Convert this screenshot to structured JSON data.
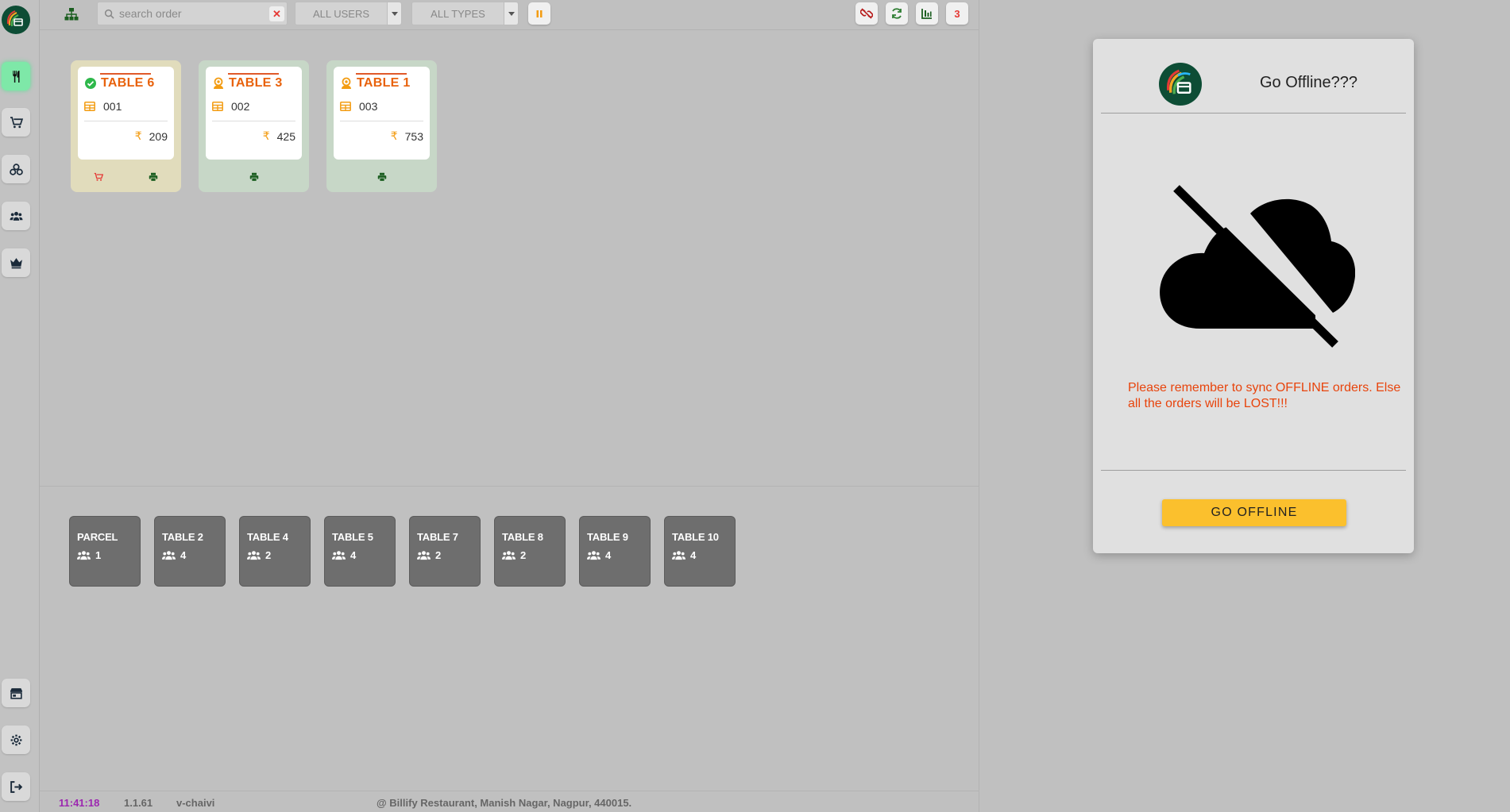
{
  "topbar": {
    "search_placeholder": "search order",
    "users_select": "ALL USERS",
    "types_select": "ALL TYPES",
    "badge_count": "3"
  },
  "occupied_tables": [
    {
      "name": "TABLE 6",
      "status": "ready",
      "order_no": "001",
      "amount": "209",
      "actions": [
        "cart-icon",
        "print-icon"
      ]
    },
    {
      "name": "TABLE 3",
      "status": "waiter",
      "order_no": "002",
      "amount": "425",
      "actions": [
        "print-icon"
      ]
    },
    {
      "name": "TABLE 1",
      "status": "waiter",
      "order_no": "003",
      "amount": "753",
      "actions": [
        "print-icon"
      ]
    }
  ],
  "currency_symbol": "₹",
  "free_tables": [
    {
      "name": "PARCEL",
      "seats": "1"
    },
    {
      "name": "TABLE 2",
      "seats": "4"
    },
    {
      "name": "TABLE 4",
      "seats": "2"
    },
    {
      "name": "TABLE 5",
      "seats": "4"
    },
    {
      "name": "TABLE 7",
      "seats": "2"
    },
    {
      "name": "TABLE 8",
      "seats": "2"
    },
    {
      "name": "TABLE 9",
      "seats": "4"
    },
    {
      "name": "TABLE 10",
      "seats": "4"
    }
  ],
  "footer": {
    "time": "11:41:18",
    "version": "1.1.61",
    "user": "v-chaivi",
    "address": "@ Billify Restaurant, Manish Nagar, Nagpur, 440015."
  },
  "modal": {
    "title": "Go Offline???",
    "warning": "Please remember to sync OFFLINE orders. Else all the orders will be LOST!!!",
    "button": "GO OFFLINE"
  },
  "colors": {
    "accent_orange": "#e8620c",
    "warning_red": "#e8440c",
    "go_offline_yellow": "#fbc02d",
    "active_green": "#7ee8a8",
    "clock_purple": "#9c27b0"
  },
  "sidebar_icons": [
    "dine-in-icon",
    "cart-icon",
    "bikes-icon",
    "users-icon",
    "crown-icon",
    "store-icon",
    "gear-icon",
    "logout-icon"
  ]
}
